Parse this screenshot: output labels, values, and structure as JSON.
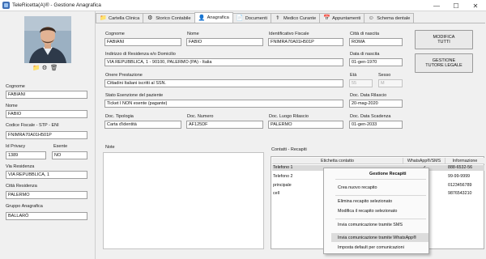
{
  "window": {
    "title": "TeleRicetta(A)® - Gestione Anagrafica",
    "minimize": "—",
    "maximize": "☐",
    "close": "✕"
  },
  "photo_tools": [
    "📁",
    "⚙",
    "🗑"
  ],
  "left": {
    "cognome": {
      "label": "Cognome",
      "value": "FABIANI"
    },
    "nome": {
      "label": "Nome",
      "value": "FABIO"
    },
    "codice": {
      "label": "Codice Fiscale - STP - ENI",
      "value": "FNIMRA70A01H501P"
    },
    "privacy": {
      "label": "Id Privacy",
      "value": "1389"
    },
    "esente": {
      "label": "Esente",
      "value": "NO"
    },
    "via": {
      "label": "Via Residenza",
      "value": "VIA REPUBBLICA, 1"
    },
    "citta": {
      "label": "Città Residenza",
      "value": "PALERMO"
    },
    "gruppo": {
      "label": "Gruppo Anagrafica",
      "value": "BALLARÒ"
    }
  },
  "tabs": [
    {
      "label": "Cartella Clinica",
      "icon": "📁"
    },
    {
      "label": "Storico Contabile",
      "icon": "⚙"
    },
    {
      "label": "Anagrafica",
      "icon": "👤"
    },
    {
      "label": "Documenti",
      "icon": "📄"
    },
    {
      "label": "Medico Curante",
      "icon": "⚕"
    },
    {
      "label": "Appuntamenti",
      "icon": "📅"
    },
    {
      "label": "Schema dentale",
      "icon": "☺"
    }
  ],
  "form": {
    "cognome": {
      "label": "Cognome",
      "value": "FABIANI"
    },
    "nome": {
      "label": "Nome",
      "value": "FABIO"
    },
    "idfiscale": {
      "label": "Identificativo Fiscale",
      "value": "FNIMRA70A01H501P"
    },
    "citta_nascita": {
      "label": "Città di nascita",
      "value": "ROMA"
    },
    "indirizzo": {
      "label": "Indirizzo di Residenza e/o Domicilio",
      "value": "VIA REPUBBLICA, 1 - 90100, PALERMO (PA) - Italia"
    },
    "data_nascita": {
      "label": "Data di nascita",
      "value": "01-gen-1970"
    },
    "onere": {
      "label": "Onere Prestazione",
      "value": "Cittadini Italiani iscritti al SSN."
    },
    "eta": {
      "label": "Età",
      "value": "55"
    },
    "sesso": {
      "label": "Sesso",
      "value": "M"
    },
    "esenzione": {
      "label": "Stato Esenzione del paziente",
      "value": "Ticket I NON esente (pagante)"
    },
    "data_rilascio": {
      "label": "Doc. Data Rilascio",
      "value": "20-mag-2020"
    },
    "tipologia": {
      "label": "Doc. Tipologia",
      "value": "Carta d'identità"
    },
    "numero": {
      "label": "Doc. Numero",
      "value": "AF125DF"
    },
    "luogo": {
      "label": "Doc. Luogo Rilascio",
      "value": "PALERMO"
    },
    "scadenza": {
      "label": "Doc. Data Scadenza",
      "value": "01-gen-2033"
    }
  },
  "buttons": {
    "modifica": [
      "MODIFICA",
      "TUTTI"
    ],
    "gestione": [
      "GESTIONE",
      "TUTORE LEGALE"
    ]
  },
  "note_label": "Note",
  "contacts": {
    "label": "Contatti - Recapiti",
    "headers": [
      "Etichetta contatto",
      "WhatsApp®/SMS",
      "Informazione"
    ],
    "rows": [
      {
        "label": "Telefono 1",
        "check": "✓",
        "info": "888-6532-56"
      },
      {
        "label": "Telefono 2",
        "check": "",
        "info": "99-99-9999"
      },
      {
        "label": "principale",
        "check": "",
        "info": "0123456789"
      },
      {
        "label": "cell",
        "check": "",
        "info": "9876543210"
      }
    ]
  },
  "context_menu": {
    "title": "Gestione Recapiti",
    "items": [
      "Crea nuovo recapito",
      "Elimina recapito selezionato",
      "Modifica il recapito selezionato",
      "Invia comunicazione tramite SMS",
      "Invia comunicazione tramite WhatsApp®",
      "Imposta default per comunicazioni"
    ]
  }
}
